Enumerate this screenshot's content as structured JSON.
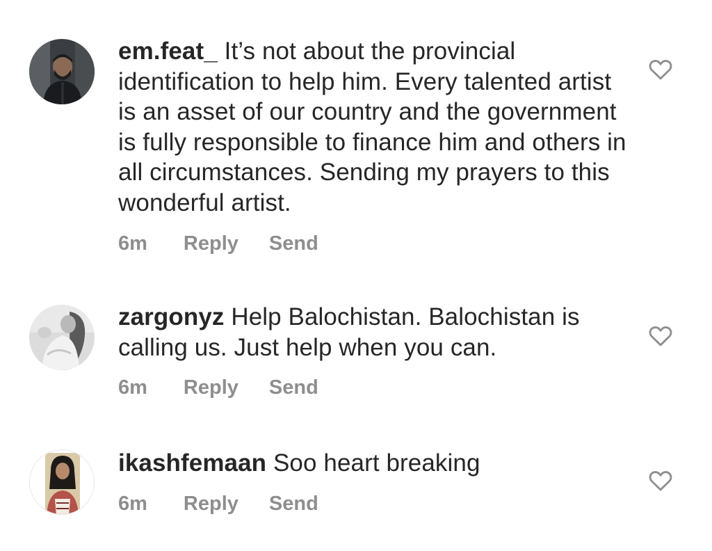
{
  "comments": [
    {
      "username": "em.feat_",
      "text": "It’s not about the provincial identification to help him. Every talented artist is an asset of our country and the government is fully responsible to finance him and others in all circumstances. Sending my prayers to this wonderful artist.",
      "time": "6m",
      "reply_label": "Reply",
      "send_label": "Send",
      "avatar": "avatar-man-photo",
      "like_icon": "heart-outline-icon"
    },
    {
      "username": "zargonyz",
      "text": "Help Balochistan. Balochistan is calling us. Just help when you can.",
      "time": "6m",
      "reply_label": "Reply",
      "send_label": "Send",
      "avatar": "avatar-grayscale-photo",
      "like_icon": "heart-outline-icon"
    },
    {
      "username": "ikashfemaan",
      "text": "Soo heart breaking",
      "time": "6m",
      "reply_label": "Reply",
      "send_label": "Send",
      "avatar": "avatar-woman-photo",
      "like_icon": "heart-outline-icon"
    }
  ],
  "colors": {
    "text": "#262626",
    "meta": "#8e8e8e",
    "icon": "#8e8e8e",
    "background": "#ffffff"
  }
}
